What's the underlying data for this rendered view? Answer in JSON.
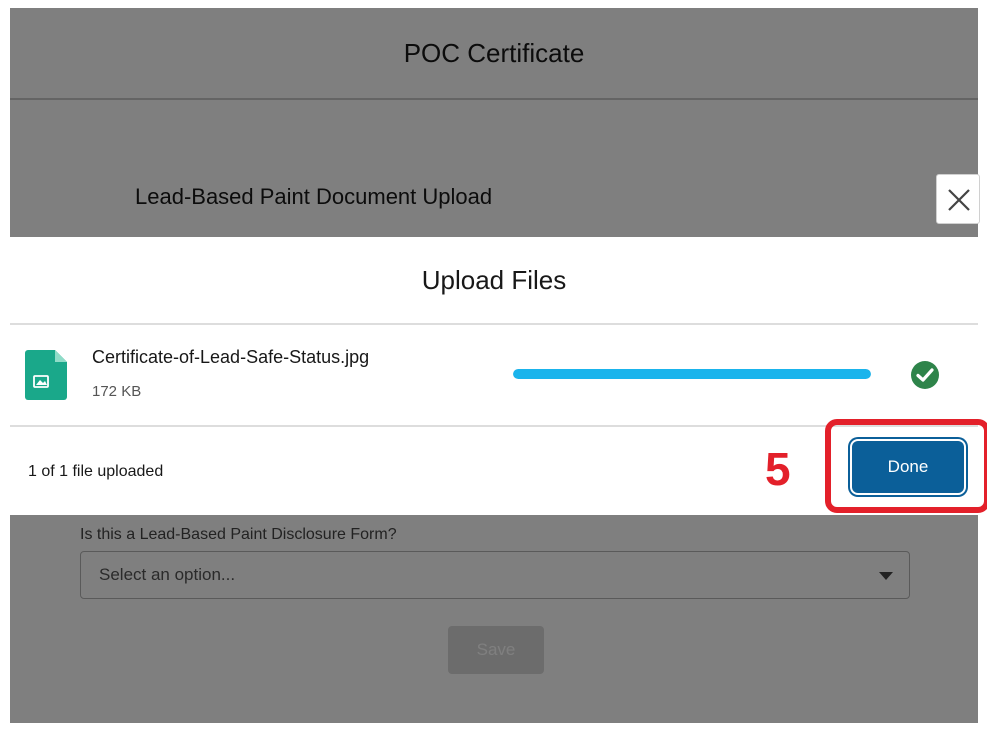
{
  "background": {
    "title": "POC Certificate",
    "subtitle": "Lead-Based Paint Document Upload",
    "question": "Is this a Lead-Based Paint Disclosure Form?",
    "select_placeholder": "Select an option...",
    "save_label": "Save"
  },
  "modal": {
    "title": "Upload Files",
    "file": {
      "name": "Certificate-of-Lead-Safe-Status.jpg",
      "size": "172 KB",
      "progress": 1.0,
      "icon": "image-file-icon",
      "status_icon": "success-check-icon"
    },
    "footer": {
      "status": "1 of 1 file uploaded",
      "step_number": "5",
      "done_label": "Done"
    }
  },
  "colors": {
    "accent": "#0b5f99",
    "progress": "#1ab4ec",
    "success": "#2e844a",
    "file_icon": "#1aa88a",
    "annotation": "#e3202a"
  }
}
